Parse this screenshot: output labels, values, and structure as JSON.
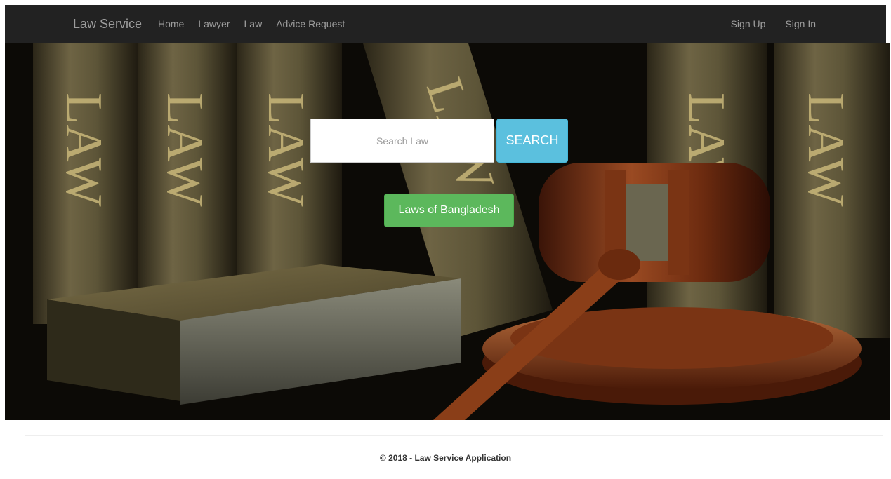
{
  "nav": {
    "brand": "Law Service",
    "left_links": [
      "Home",
      "Lawyer",
      "Law",
      "Advice Request"
    ],
    "right_links": [
      "Sign Up",
      "Sign In"
    ]
  },
  "hero": {
    "book_spine_text": "LAW",
    "search": {
      "placeholder": "Search Law",
      "value": ""
    },
    "search_button": "SEARCH",
    "laws_button": "Laws of Bangladesh"
  },
  "footer": {
    "text": "© 2018 - Law Service Application"
  },
  "colors": {
    "navbar_bg": "#222222",
    "nav_text": "#9d9d9d",
    "search_button": "#5bc0de",
    "laws_button": "#5cb85c"
  }
}
